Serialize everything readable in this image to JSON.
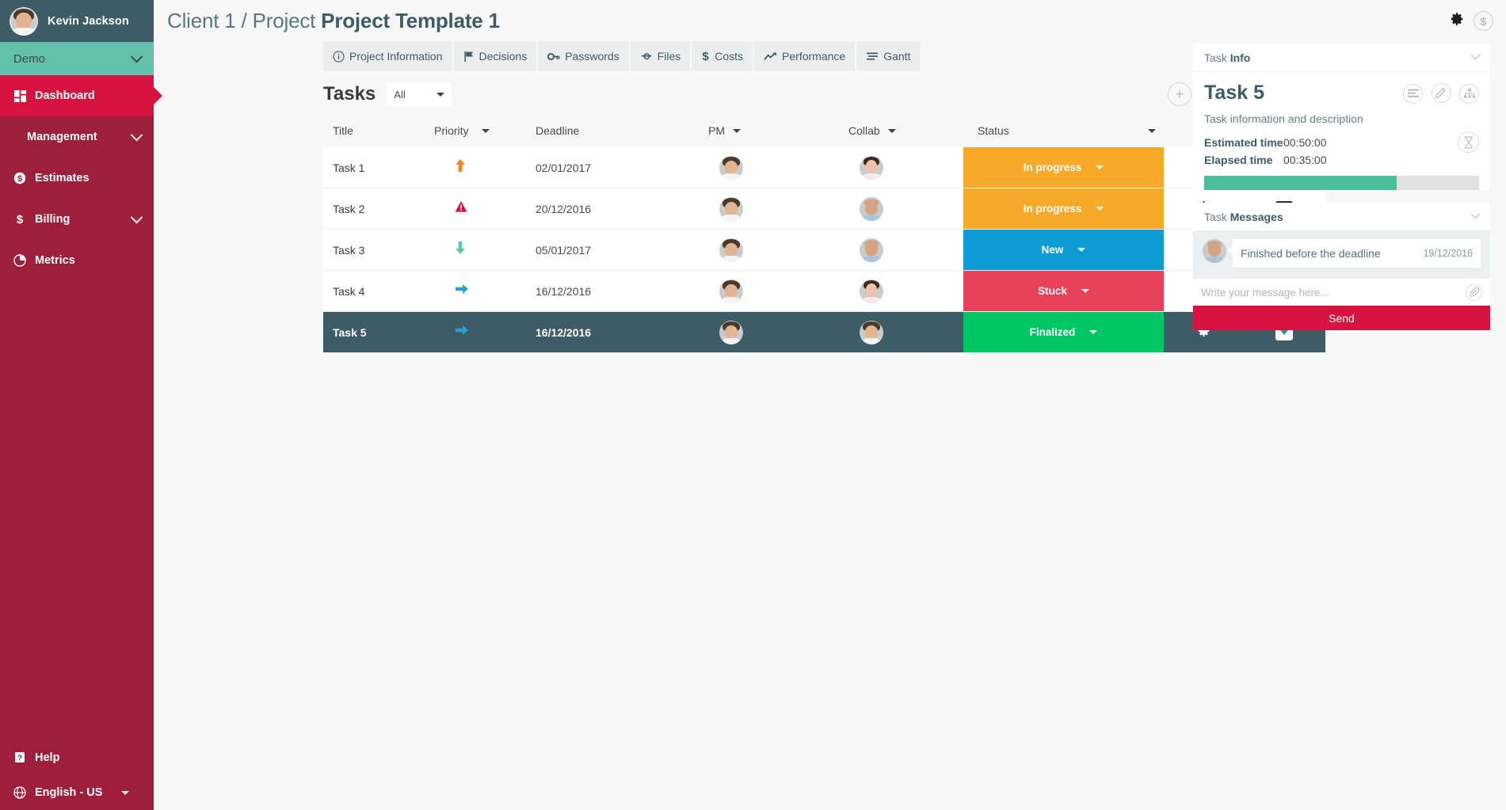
{
  "sidebar": {
    "user": {
      "name": "Kevin Jackson",
      "avatar": "user-avatar"
    },
    "workspace": {
      "label": "Demo",
      "chevron": "chevron-down-icon"
    },
    "items": [
      {
        "label": "Dashboard",
        "icon": "dashboard-grid-icon",
        "active": true,
        "chevron": ""
      },
      {
        "label": "Management",
        "icon": "",
        "active": false,
        "chevron": "chevron-down-icon"
      },
      {
        "label": "Estimates",
        "icon": "dollar-circle-icon",
        "active": false,
        "chevron": ""
      },
      {
        "label": "Billing",
        "icon": "dollar-sign-icon",
        "active": false,
        "chevron": "chevron-down-icon"
      },
      {
        "label": "Metrics",
        "icon": "pie-chart-icon",
        "active": false,
        "chevron": ""
      }
    ],
    "bottom": [
      {
        "label": "Help",
        "icon": "help-question-icon",
        "caret": false
      },
      {
        "label": "English - US",
        "icon": "globe-icon",
        "caret": true
      }
    ],
    "colors": {
      "bg": "#9e1f3c",
      "active": "#d6123f",
      "header": "#3d5c66",
      "demo": "#63c0ad"
    }
  },
  "header": {
    "breadcrumb_prefix": "Client 1 / Project ",
    "breadcrumb_title": "Project Template 1",
    "icons": [
      {
        "name": "gear-icon"
      },
      {
        "name": "dollar-circle-icon"
      }
    ]
  },
  "tabs": [
    {
      "label": "Project Information",
      "icon": "info-circle-icon"
    },
    {
      "label": "Decisions",
      "icon": "flag-icon"
    },
    {
      "label": "Passwords",
      "icon": "key-icon"
    },
    {
      "label": "Files",
      "icon": "paperclip-icon"
    },
    {
      "label": "Costs",
      "icon": "dollar-sign-icon"
    },
    {
      "label": "Performance",
      "icon": "trend-line-icon"
    },
    {
      "label": "Gantt",
      "icon": "gantt-bars-icon"
    }
  ],
  "tasks_section": {
    "title": "Tasks",
    "filter": {
      "value": "All",
      "placeholder": "All",
      "caret": "caret-down-icon"
    },
    "add_button": "+"
  },
  "table": {
    "columns": [
      {
        "label": "Title",
        "sortable": false
      },
      {
        "label": "Priority",
        "sortable": true
      },
      {
        "label": "Deadline",
        "sortable": false
      },
      {
        "label": "PM",
        "sortable": true
      },
      {
        "label": "Collab",
        "sortable": true
      },
      {
        "label": "Status",
        "sortable": true
      }
    ],
    "rows": [
      {
        "title": "Task 1",
        "priority": "up-arrow-icon",
        "priority_color": "#f5821f",
        "deadline": "02/01/2017",
        "pm": "man-beard-avatar",
        "collab": "woman-avatar",
        "status": "In progress",
        "status_color": "#f7a929",
        "selected": false
      },
      {
        "title": "Task 2",
        "priority": "warning-triangle-icon",
        "priority_color": "#d6123f",
        "deadline": "20/12/2016",
        "pm": "man-beard-avatar",
        "collab": "man-glasses-avatar",
        "status": "In progress",
        "status_color": "#f7a929",
        "selected": false
      },
      {
        "title": "Task 3",
        "priority": "down-arrow-icon",
        "priority_color": "#5cc8a4",
        "deadline": "05/01/2017",
        "pm": "man-beard-avatar",
        "collab": "man-glasses-avatar",
        "status": "New",
        "status_color": "#0d9cd4",
        "selected": false
      },
      {
        "title": "Task 4",
        "priority": "right-arrow-icon",
        "priority_color": "#2b9fd4",
        "deadline": "16/12/2016",
        "pm": "man-beard-avatar",
        "collab": "woman-avatar",
        "status": "Stuck",
        "status_color": "#e8415c",
        "selected": false
      },
      {
        "title": "Task 5",
        "priority": "right-arrow-icon",
        "priority_color": "#2b9fd4",
        "deadline": "16/12/2016",
        "pm": "man-beard-avatar",
        "collab": "man-beard-avatar",
        "status": "Finalized",
        "status_color": "#00c764",
        "selected": true
      }
    ],
    "row_actions": {
      "settings": "gear-icon",
      "archive": "archive-down-icon"
    }
  },
  "task_info": {
    "panel_label_light": "Task ",
    "panel_label_bold": "Info",
    "task_name": "Task 5",
    "actions": [
      {
        "name": "list-lines-icon"
      },
      {
        "name": "pencil-edit-icon"
      },
      {
        "name": "sitemap-icon"
      }
    ],
    "description": "Task information and description",
    "estimated_label": "Estimated time",
    "estimated_value": "00:50:00",
    "elapsed_label": "Elapsed time",
    "elapsed_value": "00:35:00",
    "hourglass_icon": "hourglass-icon",
    "progress_percent": 70,
    "progress_color": "#4cbf9c"
  },
  "task_messages": {
    "panel_label_light": "Task ",
    "panel_label_bold": "Messages",
    "messages": [
      {
        "avatar": "man-glasses-avatar",
        "text": "Finished before the deadline",
        "date": "19/12/2016"
      }
    ],
    "input_placeholder": "Write your message here...",
    "attach_icon": "paperclip-icon",
    "send_label": "Send",
    "send_color": "#d6123f"
  }
}
